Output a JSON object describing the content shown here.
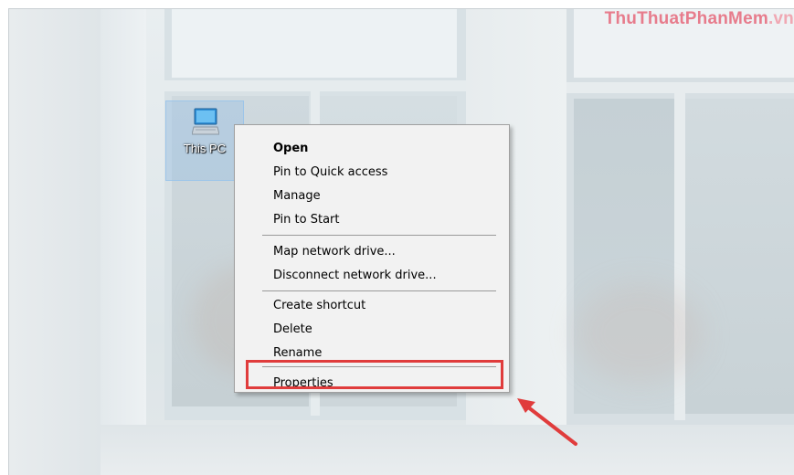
{
  "watermark": {
    "part1": "ThuThuat",
    "part2": "PhanMem",
    "part3": ".vn"
  },
  "desktop": {
    "icon_label": "This PC",
    "icon_name": "computer-icon"
  },
  "context_menu": {
    "items": [
      {
        "label": "Open",
        "bold": true
      },
      {
        "label": "Pin to Quick access"
      },
      {
        "label": "Manage"
      },
      {
        "label": "Pin to Start"
      },
      {
        "label": "Map network drive..."
      },
      {
        "label": "Disconnect network drive..."
      },
      {
        "label": "Create shortcut"
      },
      {
        "label": "Delete"
      },
      {
        "label": "Rename"
      },
      {
        "label": "Properties",
        "highlighted": true
      }
    ]
  },
  "annotation": {
    "highlight_color": "#e03c3c",
    "arrow_color": "#e03c3c"
  }
}
